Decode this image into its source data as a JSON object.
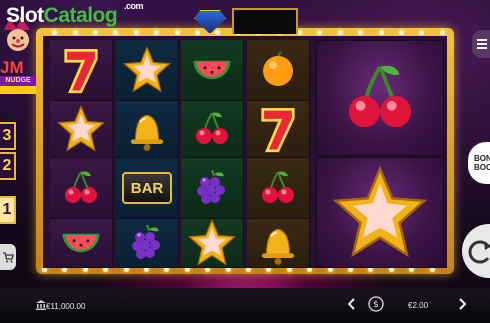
{
  "watermark": {
    "part1": "Slot",
    "part2": "Catalog",
    "suffix": ".com"
  },
  "logo": {
    "letters": "JM",
    "ribbon": "NUDGE"
  },
  "multipliers": [
    {
      "value": "3",
      "active": false
    },
    {
      "value": "2",
      "active": false
    },
    {
      "value": "1",
      "active": true
    }
  ],
  "grid": {
    "rows": [
      [
        "seven",
        "star",
        "watermelon",
        "orange"
      ],
      [
        "star",
        "bell",
        "cherry",
        "seven"
      ],
      [
        "cherry",
        "bar",
        "grapes",
        "cherry"
      ],
      [
        "watermelon",
        "grapes",
        "star",
        "bell"
      ]
    ],
    "bar_label": "BAR"
  },
  "big_symbols": [
    "cherry",
    "star"
  ],
  "side_buttons": {
    "bonus_line1": "BON",
    "bonus_line2": "BOO"
  },
  "bottom_bar": {
    "balance": "€11,000.00",
    "bet": "€2.00",
    "icons": [
      "bank-icon",
      "coin-stack-icon",
      "chevron-left-icon",
      "chevron-right-icon"
    ]
  },
  "colors": {
    "frame": "#f3c23a",
    "accent": "#ff2fa8",
    "watermark_green": "#3fbf3a"
  }
}
